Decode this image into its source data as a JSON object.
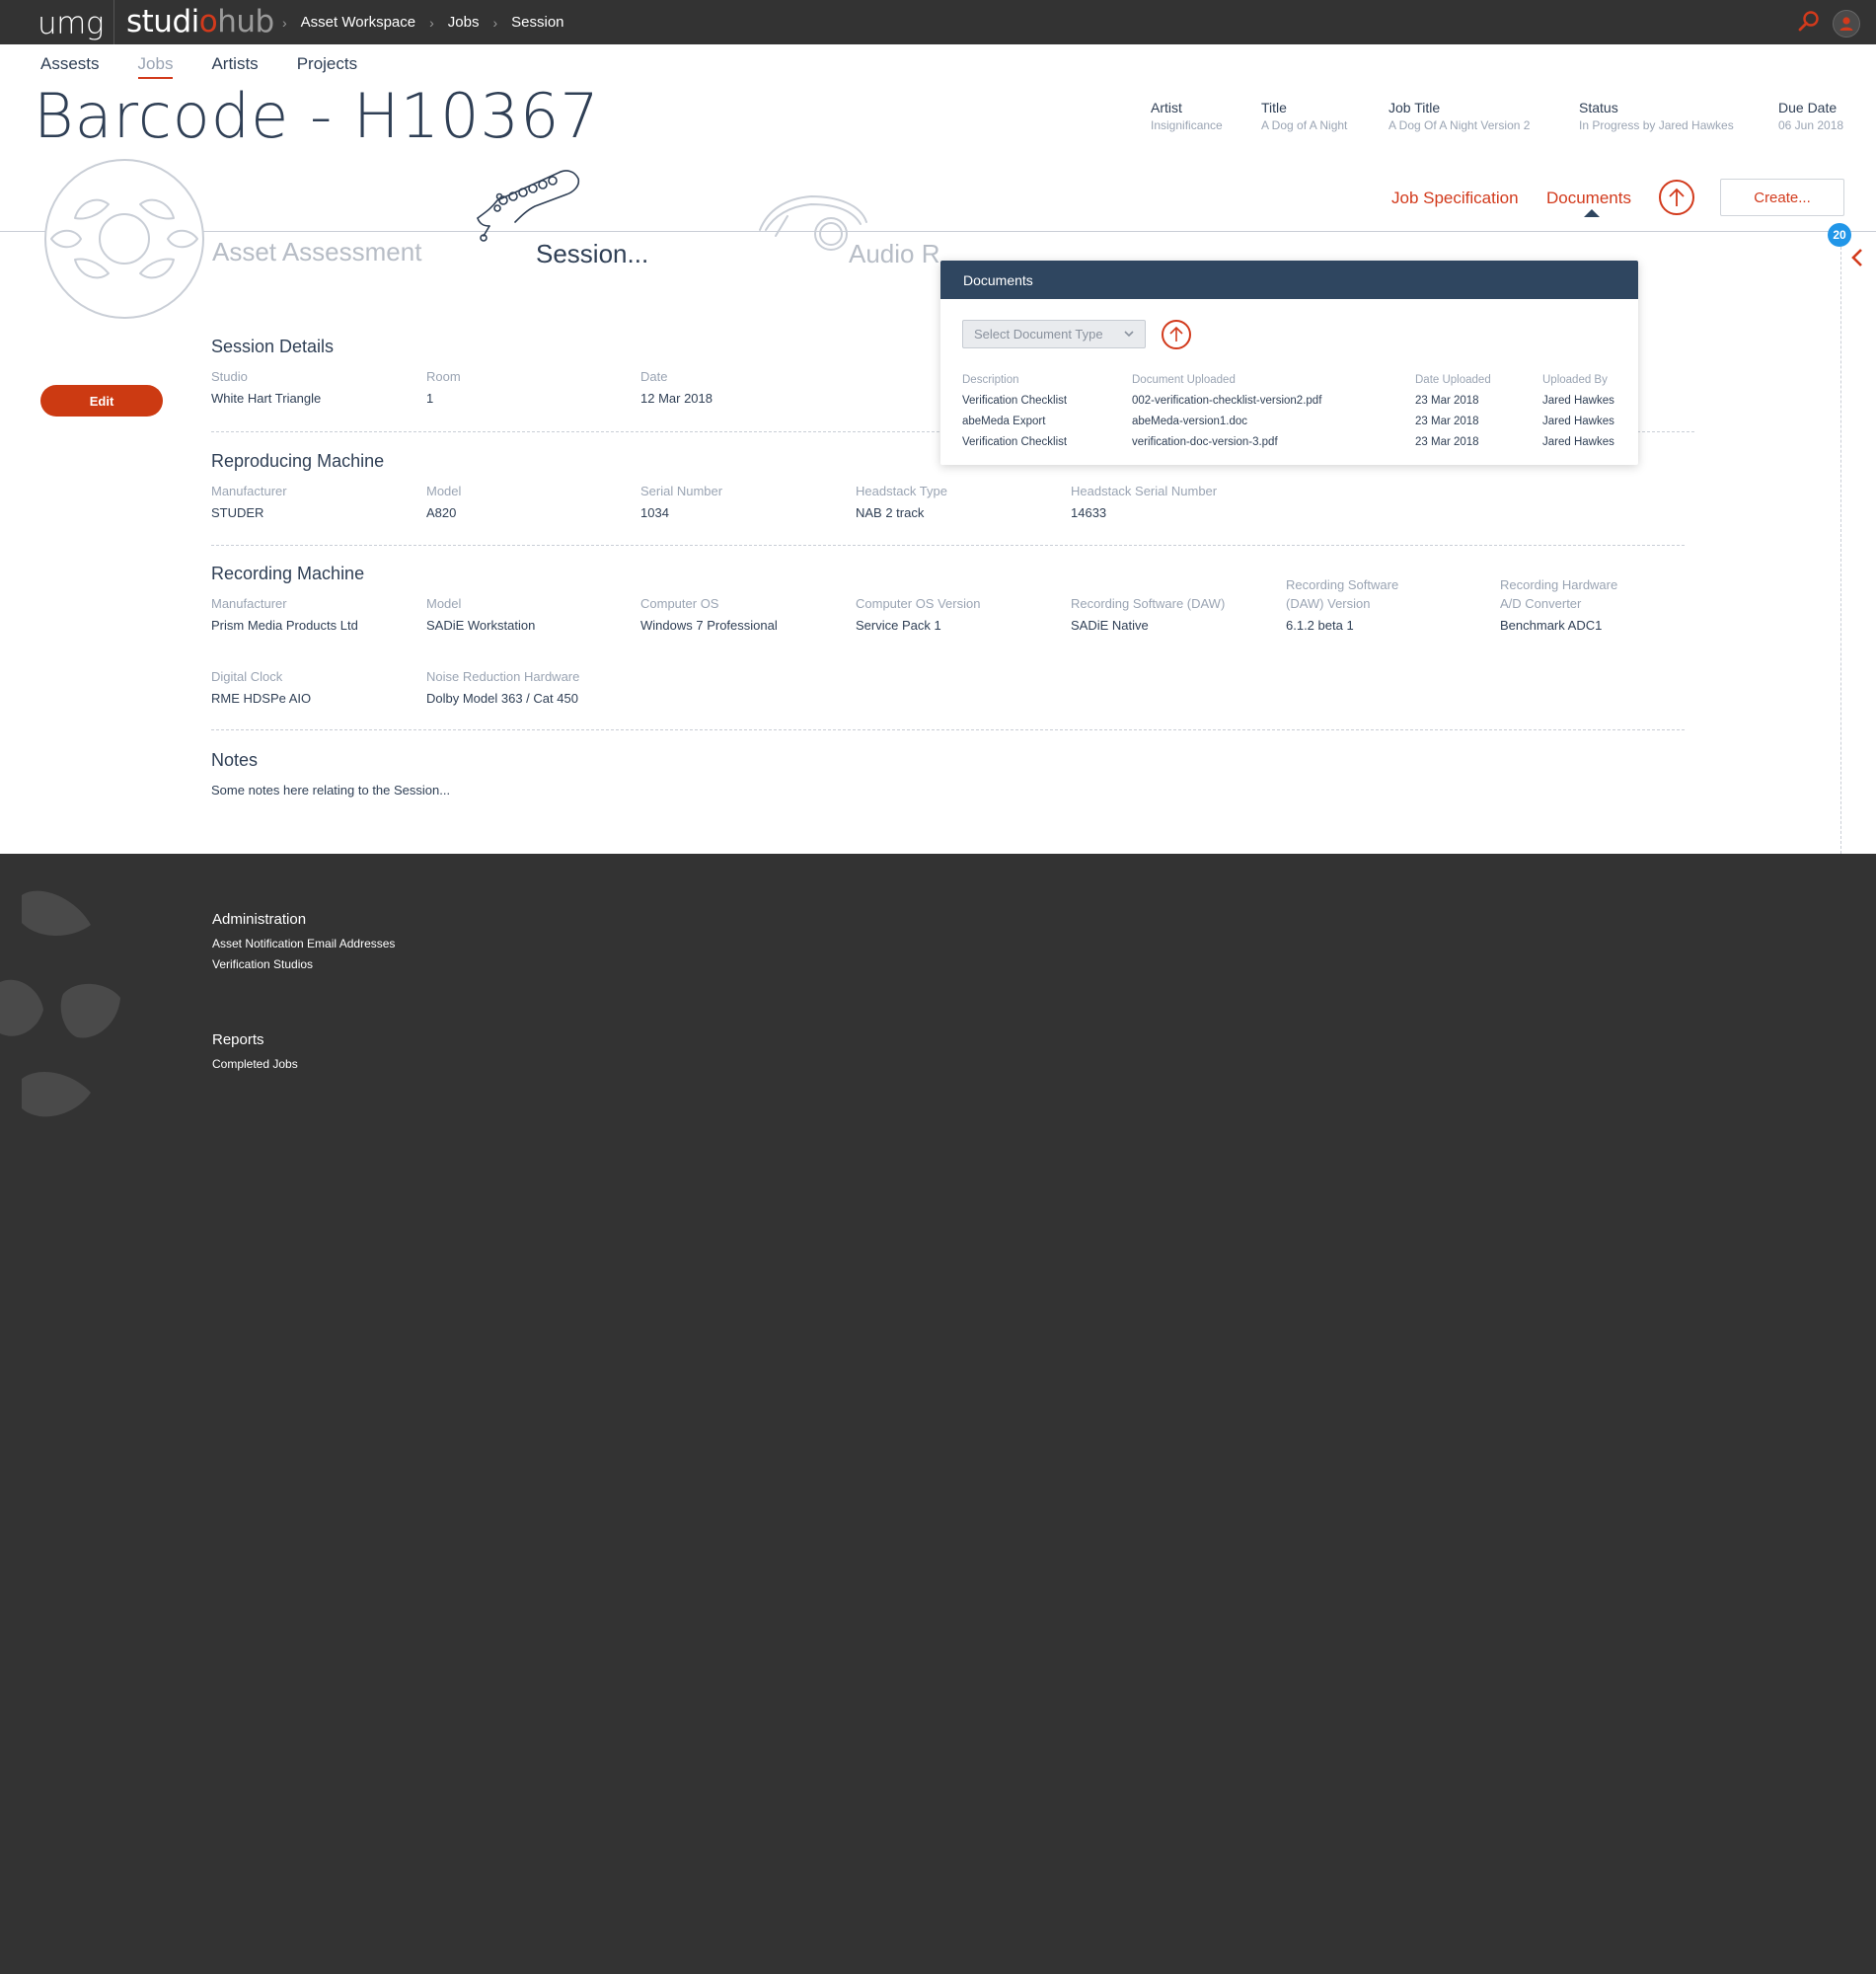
{
  "topbar": {
    "logo_left": "umg",
    "logo_studio_a": "studi",
    "logo_studio_b": "o",
    "logo_studio_c": "hub",
    "breadcrumb": [
      "Asset Workspace",
      "Jobs",
      "Session"
    ],
    "icons": [
      "search-icon",
      "user-icon"
    ],
    "accent": "#d23a1c"
  },
  "subnav": {
    "tabs": [
      "Assests",
      "Jobs",
      "Artists",
      "Projects"
    ],
    "active": "Jobs"
  },
  "page": {
    "title": "Barcode - H10367"
  },
  "meta": [
    {
      "key": "Artist",
      "value": "Insignificance"
    },
    {
      "key": "Title",
      "value": "A Dog of A Night"
    },
    {
      "key": "Job Title",
      "value": "A Dog Of A Night Version 2"
    },
    {
      "key": "Status",
      "value": "In Progress by Jared Hawkes"
    },
    {
      "key": "Due Date",
      "value": "06 Jun 2018"
    }
  ],
  "stages": {
    "asset": "Asset Assessment",
    "session": "Session...",
    "audio": "Audio R"
  },
  "actions": {
    "job_spec": "Job Specification",
    "documents": "Documents",
    "create": "Create...",
    "badge": "20"
  },
  "edit_label": "Edit",
  "session_details": {
    "title": "Session Details",
    "fields": [
      {
        "label": "Studio",
        "value": "White Hart Triangle"
      },
      {
        "label": "Room",
        "value": "1"
      },
      {
        "label": "Date",
        "value": "12 Mar 2018"
      }
    ]
  },
  "reproducing": {
    "title": "Reproducing Machine",
    "fields": [
      {
        "label": "Manufacturer",
        "value": "STUDER"
      },
      {
        "label": "Model",
        "value": "A820"
      },
      {
        "label": "Serial Number",
        "value": "1034"
      },
      {
        "label": "Headstack Type",
        "value": "NAB 2 track"
      },
      {
        "label": "Headstack Serial Number",
        "value": "14633"
      }
    ]
  },
  "recording": {
    "title": "Recording Machine",
    "row1": [
      {
        "label": "Manufacturer",
        "value": "Prism Media Products Ltd"
      },
      {
        "label": "Model",
        "value": "SADiE Workstation"
      },
      {
        "label": "Computer OS",
        "value": "Windows 7 Professional"
      },
      {
        "label": "Computer OS Version",
        "value": "Service Pack 1"
      },
      {
        "label": "Recording Software (DAW)",
        "value": "SADiE Native"
      },
      {
        "label": "Recording Software (DAW) Version",
        "label_a": "Recording Software",
        "label_b": "(DAW) Version",
        "value": "6.1.2 beta 1"
      },
      {
        "label": "Recording Hardware A/D Converter",
        "label_a": "Recording Hardware",
        "label_b": "A/D Converter",
        "value": "Benchmark ADC1"
      }
    ],
    "row2": [
      {
        "label": "Digital Clock",
        "value": "RME HDSPe AIO"
      },
      {
        "label": "Noise Reduction Hardware",
        "value": "Dolby Model 363 / Cat 450"
      }
    ]
  },
  "notes": {
    "title": "Notes",
    "text": "Some notes here relating to the Session..."
  },
  "documents_popup": {
    "title": "Documents",
    "select_placeholder": "Select Document Type",
    "columns": [
      "Description",
      "Document Uploaded",
      "Date Uploaded",
      "Uploaded By"
    ],
    "rows": [
      [
        "Verification Checklist",
        "002-verification-checklist-version2.pdf",
        "23 Mar 2018",
        "Jared Hawkes"
      ],
      [
        "abeMeda Export",
        "abeMeda-version1.doc",
        "23 Mar 2018",
        "Jared Hawkes"
      ],
      [
        "Verification Checklist",
        "verification-doc-version-3.pdf",
        "23 Mar 2018",
        "Jared Hawkes"
      ]
    ]
  },
  "footer": {
    "admin_title": "Administration",
    "admin_links": [
      "Asset Notification Email Addresses",
      "Verification Studios"
    ],
    "reports_title": "Reports",
    "reports_links": [
      "Completed Jobs"
    ]
  }
}
